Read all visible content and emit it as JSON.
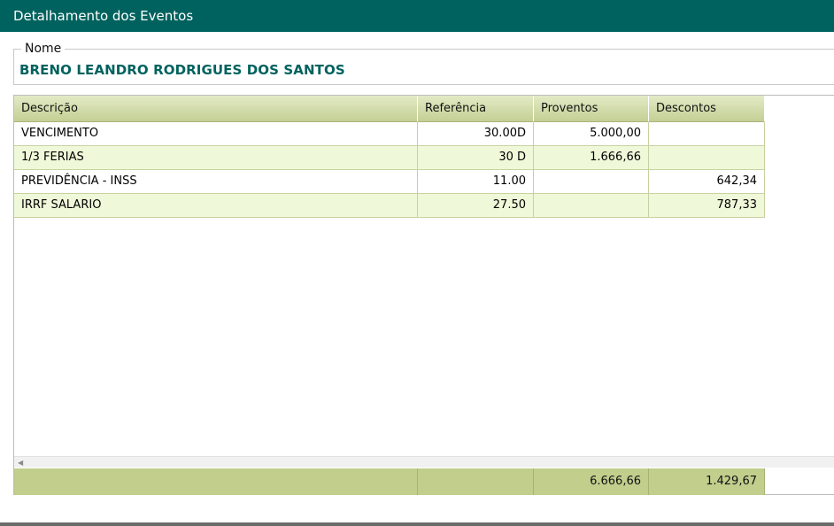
{
  "window": {
    "title": "Detalhamento dos Eventos"
  },
  "name_section": {
    "legend": "Nome",
    "value": "BRENO LEANDRO RODRIGUES DOS SANTOS"
  },
  "table": {
    "headers": [
      "Descrição",
      "Referência",
      "Proventos",
      "Descontos"
    ],
    "rows": [
      {
        "descricao": "VENCIMENTO",
        "referencia": "30.00D",
        "proventos": "5.000,00",
        "descontos": ""
      },
      {
        "descricao": "1/3 FERIAS",
        "referencia": "30 D",
        "proventos": "1.666,66",
        "descontos": ""
      },
      {
        "descricao": "PREVIDÊNCIA - INSS",
        "referencia": "11.00",
        "proventos": "",
        "descontos": "642,34"
      },
      {
        "descricao": "IRRF SALARIO",
        "referencia": "27.50",
        "proventos": "",
        "descontos": "787,33"
      }
    ],
    "totals": {
      "descricao": "",
      "referencia": "",
      "proventos": "6.666,66",
      "descontos": "1.429,67"
    }
  },
  "colors": {
    "header_bar": "#00625e",
    "name_text": "#00625e",
    "alt_row": "#eff9d9",
    "footer": "#c1ce8c"
  }
}
